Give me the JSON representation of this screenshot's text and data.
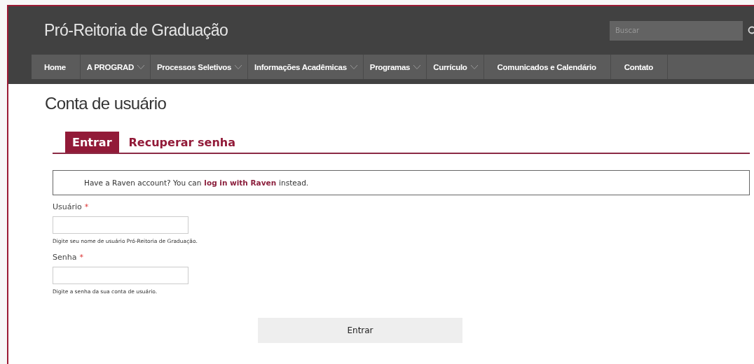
{
  "site_title": "Pró-Reitoria de Graduação",
  "search": {
    "placeholder": "Buscar"
  },
  "nav": [
    {
      "label": "Home",
      "has_dropdown": false
    },
    {
      "label": "A PROGRAD",
      "has_dropdown": true
    },
    {
      "label": "Processos Seletivos",
      "has_dropdown": true
    },
    {
      "label": "Informações Acadêmicas",
      "has_dropdown": true
    },
    {
      "label": "Programas",
      "has_dropdown": true
    },
    {
      "label": "Currículo",
      "has_dropdown": true
    },
    {
      "label": "Comunicados e Calendário",
      "has_dropdown": false
    },
    {
      "label": "Contato",
      "has_dropdown": false
    }
  ],
  "page_title": "Conta de usuário",
  "tabs": [
    {
      "label": "Entrar",
      "selected": true
    },
    {
      "label": "Recuperar senha",
      "selected": false
    }
  ],
  "notice": {
    "before": "Have a Raven account? You can",
    "link": "log in with Raven",
    "after": "instead."
  },
  "fields": [
    {
      "label": "Usuário",
      "required": true,
      "required_mark": "*",
      "hint": "Digite seu nome de usuário Pró-Reitoria de Graduação."
    },
    {
      "label": "Senha",
      "required": true,
      "required_mark": "*",
      "hint": "Digite a senha da sua conta de usuário."
    }
  ],
  "submit": "Entrar"
}
